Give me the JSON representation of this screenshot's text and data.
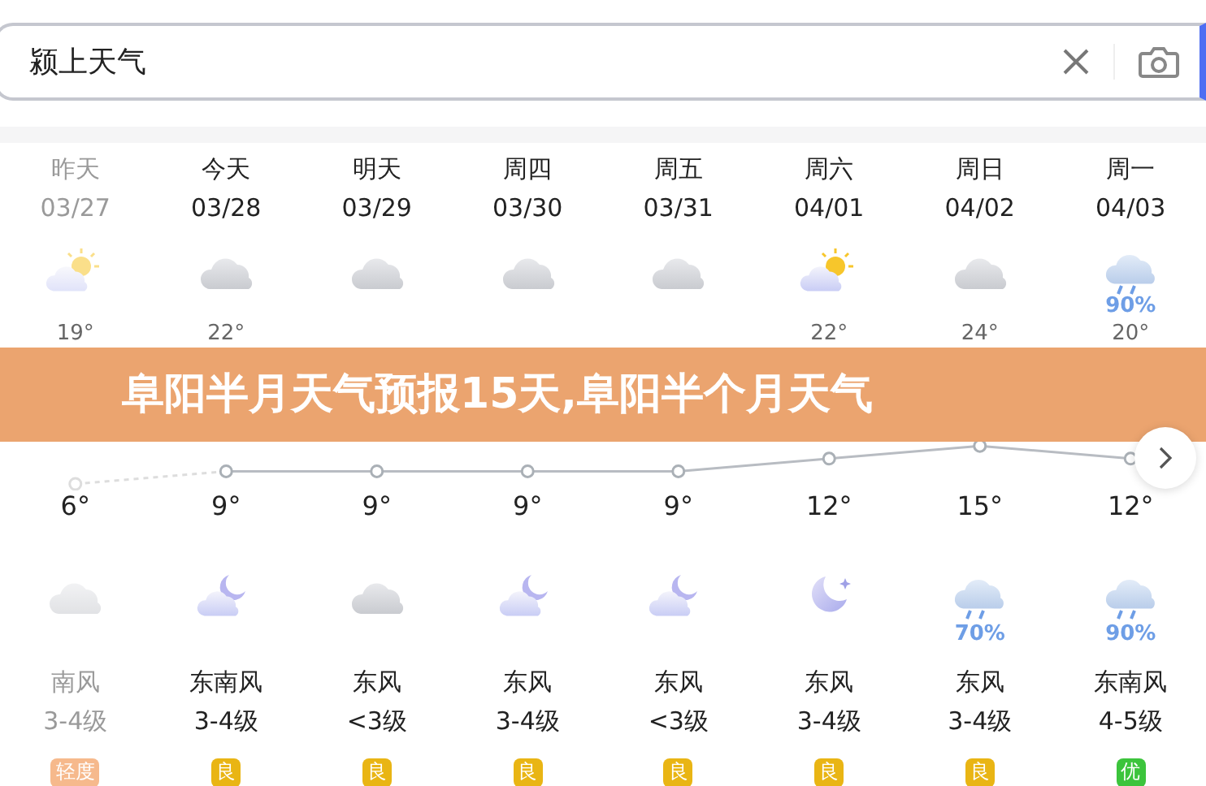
{
  "search": {
    "value": "颍上天气"
  },
  "days": [
    {
      "weekday": "昨天",
      "date": "03/27",
      "past": true,
      "day_weather": {
        "kind": "sun_cloud"
      },
      "high": "19°",
      "low": "6°",
      "night_weather": {
        "kind": "cloud"
      },
      "wind_dir": "南风",
      "wind_level": "3-4级",
      "aqi": {
        "text": "轻度",
        "color": "#f6b98c"
      }
    },
    {
      "weekday": "今天",
      "date": "03/28",
      "past": false,
      "day_weather": {
        "kind": "cloud"
      },
      "high": "22°",
      "low": "9°",
      "night_weather": {
        "kind": "cloud_moon"
      },
      "wind_dir": "东南风",
      "wind_level": "3-4级",
      "aqi": {
        "text": "良",
        "color": "#e9b514"
      }
    },
    {
      "weekday": "明天",
      "date": "03/29",
      "past": false,
      "day_weather": {
        "kind": "cloud"
      },
      "low": "9°",
      "night_weather": {
        "kind": "cloud"
      },
      "wind_dir": "东风",
      "wind_level": "<3级",
      "aqi": {
        "text": "良",
        "color": "#e9b514"
      }
    },
    {
      "weekday": "周四",
      "date": "03/30",
      "past": false,
      "day_weather": {
        "kind": "cloud"
      },
      "low": "9°",
      "night_weather": {
        "kind": "cloud_moon"
      },
      "wind_dir": "东风",
      "wind_level": "3-4级",
      "aqi": {
        "text": "良",
        "color": "#e9b514"
      }
    },
    {
      "weekday": "周五",
      "date": "03/31",
      "past": false,
      "day_weather": {
        "kind": "cloud"
      },
      "low": "9°",
      "night_weather": {
        "kind": "cloud_moon"
      },
      "wind_dir": "东风",
      "wind_level": "<3级",
      "aqi": {
        "text": "良",
        "color": "#e9b514"
      }
    },
    {
      "weekday": "周六",
      "date": "04/01",
      "past": false,
      "day_weather": {
        "kind": "sun_cloud"
      },
      "high": "22°",
      "low": "12°",
      "night_weather": {
        "kind": "moon"
      },
      "wind_dir": "东风",
      "wind_level": "3-4级",
      "aqi": {
        "text": "良",
        "color": "#e9b514"
      }
    },
    {
      "weekday": "周日",
      "date": "04/02",
      "past": false,
      "day_weather": {
        "kind": "cloud"
      },
      "high": "24°",
      "low": "15°",
      "night_weather": {
        "kind": "rain",
        "precip": "70%"
      },
      "wind_dir": "东风",
      "wind_level": "3-4级",
      "aqi": {
        "text": "良",
        "color": "#e9b514"
      }
    },
    {
      "weekday": "周一",
      "date": "04/03",
      "past": false,
      "day_weather": {
        "kind": "rain",
        "precip": "90%"
      },
      "high": "20°",
      "low": "12°",
      "night_weather": {
        "kind": "rain",
        "precip": "90%"
      },
      "wind_dir": "东南风",
      "wind_level": "4-5级",
      "aqi": {
        "text": "优",
        "color": "#3cc43c"
      }
    }
  ],
  "banner": "阜阳半月天气预报15天,阜阳半个月天气"
}
